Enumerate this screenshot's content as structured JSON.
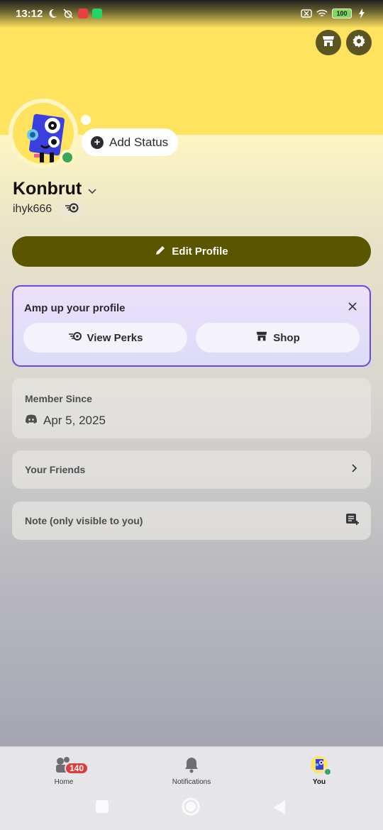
{
  "status_bar": {
    "time": "13:12",
    "battery": "100"
  },
  "header": {
    "shop_icon": "shop-icon",
    "settings_icon": "gear-icon"
  },
  "profile": {
    "display_name": "Konbrut",
    "username": "ihyk666",
    "add_status_label": "Add Status",
    "edit_profile_label": "Edit Profile",
    "presence_color": "#3ba55c"
  },
  "amp": {
    "title": "Amp up your profile",
    "view_perks_label": "View Perks",
    "shop_label": "Shop",
    "border_color": "#6b46e8"
  },
  "member_since": {
    "label": "Member Since",
    "date": "Apr 5, 2025"
  },
  "friends": {
    "label": "Your Friends"
  },
  "note": {
    "label": "Note (only visible to you)"
  },
  "bottom_nav": {
    "items": [
      {
        "label": "Home",
        "badge": "140"
      },
      {
        "label": "Notifications"
      },
      {
        "label": "You"
      }
    ]
  },
  "colors": {
    "banner": "#ffe35f",
    "accent_button": "#5b5500",
    "badge": "#e03b3b"
  }
}
